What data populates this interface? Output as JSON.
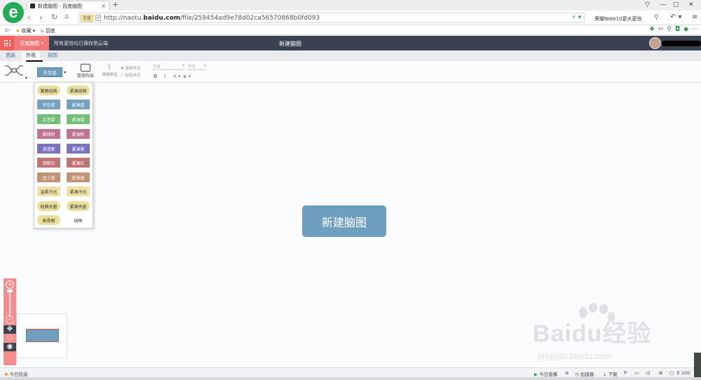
{
  "browser": {
    "tab_title": "新建脑图 - 百度脑图",
    "tab_close": "×",
    "new_tab": "+",
    "url_badge": "百度",
    "url_shield": "✓",
    "url_prefix": "http://naotu.",
    "url_domain": "baidu.com",
    "url_path": "/file/259454ad9e78d02ca56570868b0fd093",
    "search_hint": "荣耀Note10更大更快",
    "logo_letter": "e",
    "win_controls": [
      "▽",
      "—",
      "▢",
      "✕"
    ]
  },
  "bookmarks": {
    "favorites": "收藏",
    "baidu": "百度"
  },
  "app": {
    "brand": "百度脑图",
    "save_status": "所有更改均已保存到云端",
    "doc_title": "新建脑图"
  },
  "menu": {
    "tabs": [
      "思路",
      "外观",
      "视图"
    ],
    "active_index": 1
  },
  "toolbar": {
    "current_theme": "天空蓝",
    "layout_label": "整理布局",
    "clear_style_label": "清除样式",
    "copy_style_label": "复制样式",
    "paste_style_label": "粘贴样式",
    "font_family_placeholder": "字体",
    "font_size_placeholder": "字号",
    "bold": "B",
    "italic": "I",
    "font_color": "A",
    "bg_color": "◈"
  },
  "themes": [
    {
      "label": "脑图经典",
      "bg": "#e9df98",
      "fg": "#333333",
      "pill": true
    },
    {
      "label": "紧凑经典",
      "bg": "#e9df98",
      "fg": "#333333",
      "pill": true
    },
    {
      "label": "天空蓝",
      "bg": "#73a1bf",
      "fg": "#ffffff",
      "pill": false
    },
    {
      "label": "紧凑蓝",
      "bg": "#73a1bf",
      "fg": "#ffffff",
      "pill": false
    },
    {
      "label": "文艺绿",
      "bg": "#73bf76",
      "fg": "#ffffff",
      "pill": false
    },
    {
      "label": "紧凑绿",
      "bg": "#73bf76",
      "fg": "#ffffff",
      "pill": false
    },
    {
      "label": "脑残粉",
      "bg": "#bf7394",
      "fg": "#ffffff",
      "pill": false
    },
    {
      "label": "紧凑粉",
      "bg": "#bf7394",
      "fg": "#ffffff",
      "pill": false
    },
    {
      "label": "浪漫紫",
      "bg": "#7b73bf",
      "fg": "#ffffff",
      "pill": false
    },
    {
      "label": "紧凑紫",
      "bg": "#7b73bf",
      "fg": "#ffffff",
      "pill": false
    },
    {
      "label": "清新红",
      "bg": "#bf7373",
      "fg": "#ffffff",
      "pill": false
    },
    {
      "label": "紧凑红",
      "bg": "#bf7373",
      "fg": "#ffffff",
      "pill": false
    },
    {
      "label": "泥土黄",
      "bg": "#bf9373",
      "fg": "#ffffff",
      "pill": false
    },
    {
      "label": "紧凑黄",
      "bg": "#bf9373",
      "fg": "#ffffff",
      "pill": false
    },
    {
      "label": "温柔冷光",
      "bg": "#f0e2a0",
      "fg": "#333333",
      "pill": false
    },
    {
      "label": "紧凑冷光",
      "bg": "#f0e2a0",
      "fg": "#333333",
      "pill": false
    },
    {
      "label": "经典天盘",
      "bg": "#e9df98",
      "fg": "#333333",
      "pill": true
    },
    {
      "label": "紧凑天盘",
      "bg": "#e9df98",
      "fg": "#333333",
      "pill": true
    },
    {
      "label": "鱼骨图",
      "bg": "#e9df98",
      "fg": "#333333",
      "pill": true
    },
    {
      "label": "线框",
      "bg": "#ffffff",
      "fg": "#333333",
      "pill": false
    }
  ],
  "canvas": {
    "root_node": "新建脑图"
  },
  "zoom": {
    "zoom_in": "+",
    "zoom_out": "−",
    "move": "✥",
    "locate": "◌",
    "view": "◉"
  },
  "watermark": {
    "text": "Baidu经验",
    "url": "jingyan.baidu.com"
  },
  "statusbar": {
    "today": "今日优选",
    "live": "今日直播",
    "accelerator": "加速器",
    "download": "下载",
    "zoom_pct": "100"
  },
  "colors": {
    "header_bg": "#3a4150",
    "accent_red": "#f25f5c",
    "brand_pink": "#f27978",
    "node_blue": "#6f9fbe"
  }
}
